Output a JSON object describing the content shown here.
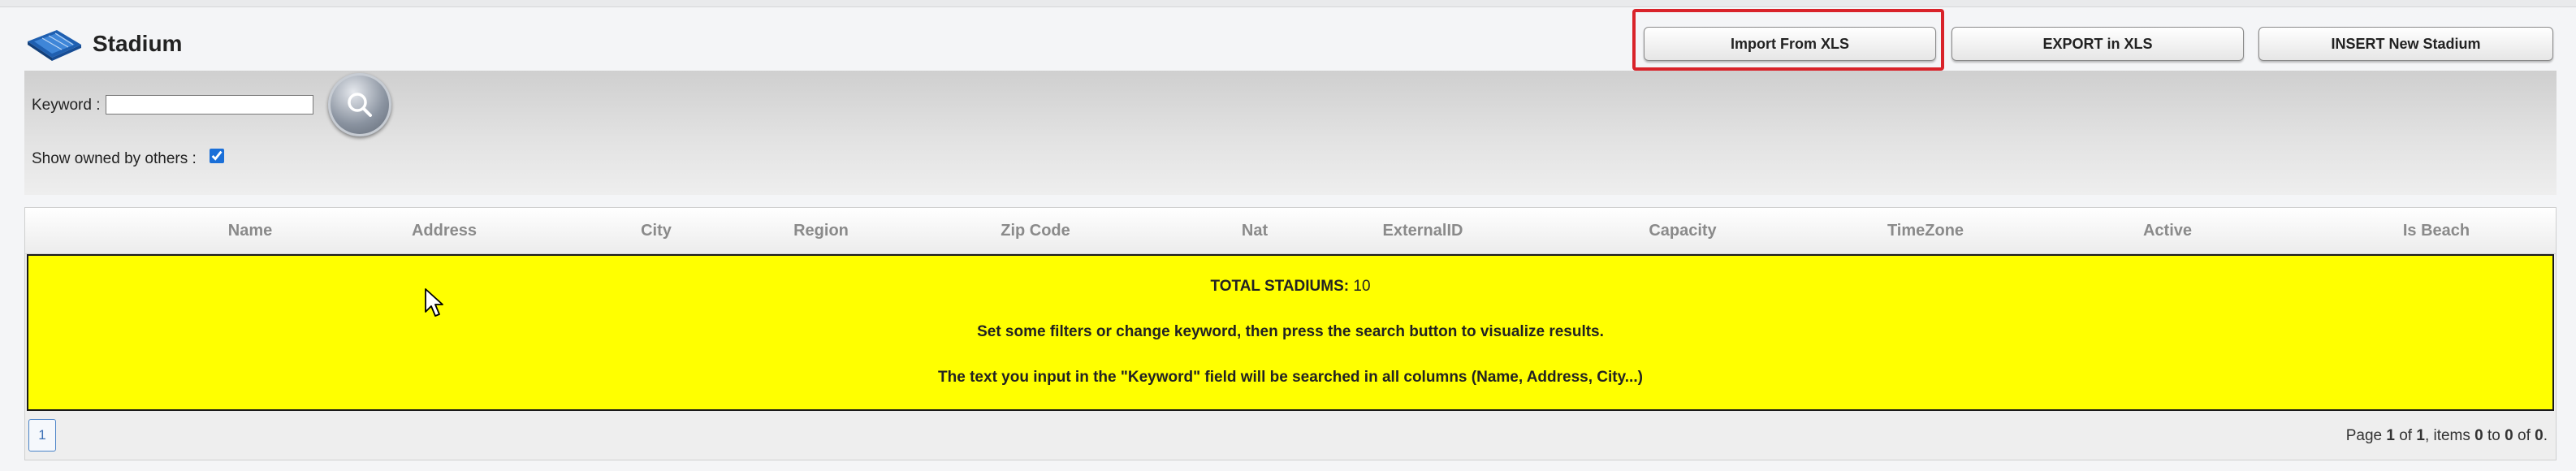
{
  "page": {
    "title": "Stadium",
    "icon": "stadium-icon"
  },
  "toolbar": {
    "import_label": "Import From XLS",
    "export_label": "EXPORT in XLS",
    "insert_label": "INSERT New Stadium",
    "highlight_color": "#d9232a"
  },
  "filters": {
    "keyword_label": "Keyword :",
    "keyword_value": "",
    "search_icon": "search-icon",
    "owned_label": "Show owned by others :",
    "owned_checked": true
  },
  "table": {
    "columns": [
      "Name",
      "Address",
      "City",
      "Region",
      "Zip Code",
      "Nat",
      "ExternalID",
      "Capacity",
      "TimeZone",
      "Active",
      "Is Beach"
    ],
    "notice": {
      "total_label": "TOTAL STADIUMS:",
      "total_value": "10",
      "line2": "Set some filters or change keyword, then press the search button to visualize results.",
      "line3": "The text you input in the \"Keyword\" field will be searched in all columns (Name, Address, City...)",
      "background_color": "#ffff00"
    }
  },
  "pagination": {
    "current_page": "1",
    "info": {
      "prefix": "Page ",
      "page": "1",
      "of_text": " of ",
      "pages": "1",
      "items_text": ", items ",
      "from": "0",
      "to_text": " to ",
      "to": "0",
      "of_items_text": " of ",
      "total": "0",
      "suffix": "."
    }
  }
}
